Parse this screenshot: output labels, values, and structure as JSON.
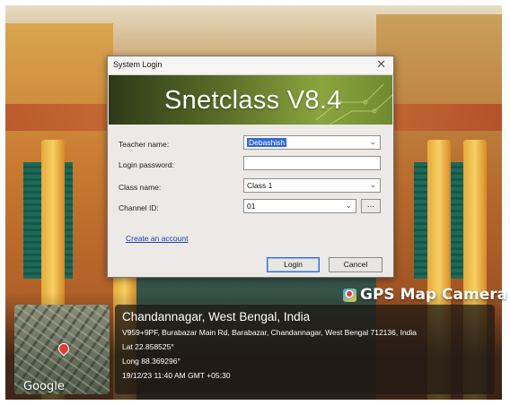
{
  "dialog": {
    "title": "System Login",
    "close_glyph": "✕",
    "banner": "Snetclass V8.4",
    "fields": {
      "teacher_label": "Teacher name:",
      "teacher_value": "Debashish",
      "password_label": "Login password:",
      "password_value": "",
      "class_label": "Class name:",
      "class_value": "Class 1",
      "channel_label": "Channel ID:",
      "channel_value": "01",
      "ellipsis": "..."
    },
    "create_account": "Create an account",
    "login_button": "Login",
    "cancel_button": "Cancel",
    "arrow_glyph": "⌄"
  },
  "gps": {
    "badge": "GPS Map Camera",
    "city": "Chandannagar, West Bengal, India",
    "address": "V959+9PF, Burabazar Main Rd, Barabazar, Chandannagar, West Bengal 712136, India",
    "lat": "Lat 22.858525°",
    "long": "Long 88.369296°",
    "datetime": "19/12/23 11:40 AM GMT +05:30",
    "map_brand": "Google"
  },
  "colors": {
    "selection": "#2f6bd6",
    "link": "#1a3fb0"
  }
}
